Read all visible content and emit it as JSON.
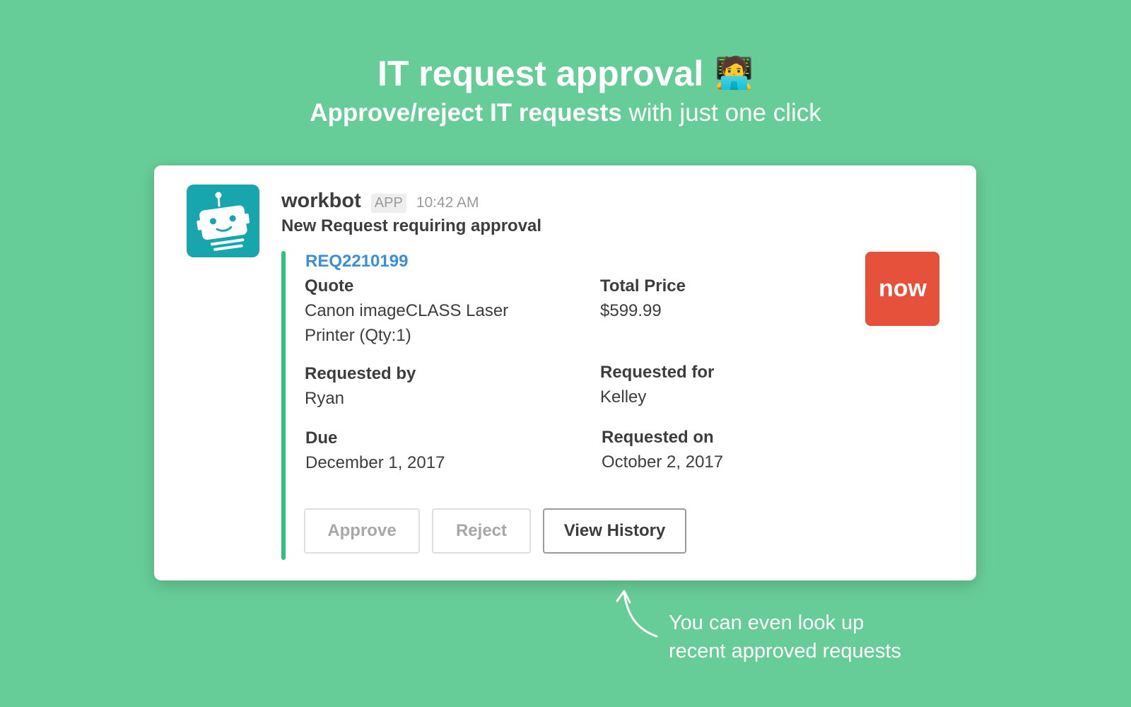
{
  "hero": {
    "title": "IT request approval",
    "title_emoji": "🧑‍💻",
    "subtitle_bold": "Approve/reject IT requests",
    "subtitle_rest": " with just one click"
  },
  "message": {
    "bot_name": "workbot",
    "app_badge": "APP",
    "time": "10:42 AM",
    "text": "New Request requiring approval",
    "avatar_icon": "robot-icon"
  },
  "attachment": {
    "accent_color": "#2fc27f",
    "request_id": "REQ2210199",
    "logo_text": "now",
    "logo_color": "#e5513a",
    "fields": {
      "quote": {
        "label": "Quote",
        "value_line1": "Canon imageCLASS Laser",
        "value_line2": "Printer (Qty:1)"
      },
      "total_price": {
        "label": "Total Price",
        "value": "$599.99"
      },
      "requested_by": {
        "label": "Requested by",
        "value": "Ryan"
      },
      "requested_for": {
        "label": "Requested for",
        "value": "Kelley"
      },
      "due": {
        "label": "Due",
        "value": "December 1, 2017"
      },
      "requested_on": {
        "label": "Requested on",
        "value": "October 2, 2017"
      }
    }
  },
  "actions": {
    "approve": "Approve",
    "reject": "Reject",
    "view_history": "View History"
  },
  "note": {
    "line1": "You can even look up",
    "line2": "recent approved requests"
  },
  "colors": {
    "background": "#67cd98",
    "bot_avatar": "#17a6ad",
    "link": "#3b8fd6"
  }
}
